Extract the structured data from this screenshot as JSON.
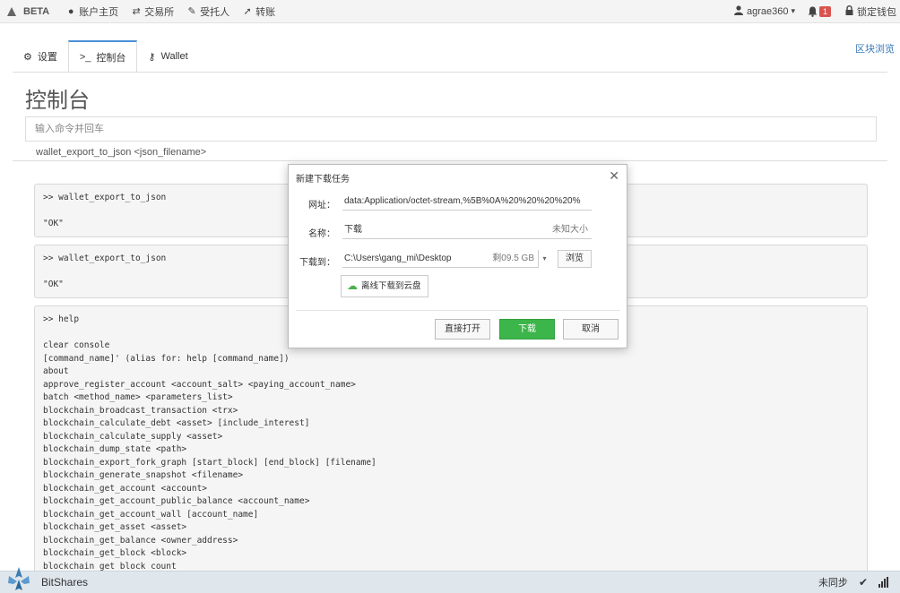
{
  "nav": {
    "brand": "BETA",
    "items": [
      {
        "icon": "user-home-icon",
        "glyph": "●",
        "label": "账户主页"
      },
      {
        "icon": "exchange-icon",
        "glyph": "⇄",
        "label": "交易所"
      },
      {
        "icon": "delegate-icon",
        "glyph": "✎",
        "label": "受托人"
      },
      {
        "icon": "transfer-icon",
        "glyph": "➚",
        "label": "转账"
      }
    ],
    "user": "agrae360",
    "user_caret": "▾",
    "notif_count": "1",
    "lock_label": "锁定钱包"
  },
  "tabs": [
    {
      "icon": "gears-icon",
      "glyph": "⚙",
      "label": "设置"
    },
    {
      "icon": "terminal-icon",
      "glyph": ">_",
      "label": "控制台"
    },
    {
      "icon": "key-icon",
      "glyph": "⚷",
      "label": "Wallet"
    }
  ],
  "block_browser": "区块浏览",
  "page_title": "控制台",
  "command_input_placeholder": "输入命令并回车",
  "hint": "wallet_export_to_json <json_filename>",
  "console": {
    "entry1": ">> wallet_export_to_json\n\n\"OK\"",
    "entry2": ">> wallet_export_to_json\n\n\"OK\"",
    "entry3": ">> help\n\nclear console\n[command_name]' (alias for: help [command_name])\nabout\napprove_register_account <account_salt> <paying_account_name>\nbatch <method_name> <parameters_list>\nblockchain_broadcast_transaction <trx>\nblockchain_calculate_debt <asset> [include_interest]\nblockchain_calculate_supply <asset>\nblockchain_dump_state <path>\nblockchain_export_fork_graph [start_block] [end_block] [filename]\nblockchain_generate_snapshot <filename>\nblockchain_get_account <account>\nblockchain_get_account_public_balance <account_name>\nblockchain_get_account_wall [account_name]\nblockchain_get_asset <asset>\nblockchain_get_balance <owner_address>\nblockchain_get_block <block>\nblockchain_get_block_count"
  },
  "footer": {
    "name": "BitShares",
    "status": "未同步",
    "check_glyph": "✔"
  },
  "dialog": {
    "title": "新建下载任务",
    "close_glyph": "✕",
    "url_label": "网址：",
    "url_value": "data:Application/octet-stream,%5B%0A%20%20%20%20%",
    "name_label": "名称：",
    "name_value": "下载",
    "name_size": "未知大小",
    "dest_label": "下载到：",
    "dest_path": "C:\\Users\\gang_mi\\Desktop",
    "dest_free": "剩09.5 GB",
    "dest_caret": "▾",
    "browse": "浏览",
    "cloud_button": "离线下载到云盘",
    "cloud_glyph": "☁",
    "open_button": "直接打开",
    "download_button": "下载",
    "cancel_button": "取消"
  }
}
